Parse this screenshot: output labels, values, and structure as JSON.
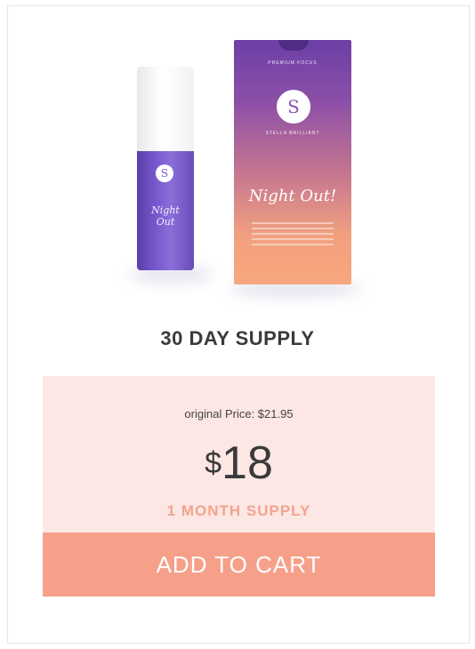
{
  "product": {
    "box_top_text": "PREMIUM FOCUS",
    "logo_letter": "S",
    "brand_name": "STELLA BRILLIANT",
    "product_script": "Night Out!",
    "bottle_script": "Night Out"
  },
  "offer": {
    "supply_title": "30 DAY SUPPLY",
    "original_price": "original Price: $21.95",
    "currency": "$",
    "price": "18",
    "duration": "1 MONTH SUPPLY",
    "cta_label": "ADD TO CART"
  },
  "colors": {
    "accent": "#f6a08a",
    "panel_bg": "#fce7e4",
    "supply_text": "#f2a48f",
    "product_purple": "#7a5ad0"
  }
}
